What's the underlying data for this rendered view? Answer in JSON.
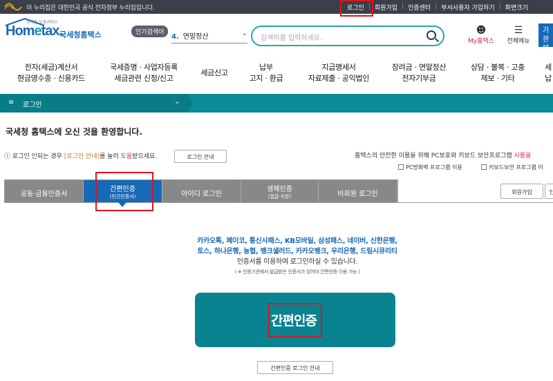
{
  "topbar": {
    "gov_text": "이 누리집은 대한민국 공식 전자정부 누리집입니다.",
    "links": [
      "로그인",
      "회원가입",
      "인증센터",
      "부서사용자 가입하기",
      "화면크기"
    ]
  },
  "header": {
    "slogan": "언제든 도움서비스",
    "logo_home": "Hom",
    "logo_e": "e",
    "logo_tax": "tax.",
    "site_name": "국세청홈택스",
    "popular_label": "인기검색어",
    "keyword_rank": "4.",
    "keyword": "연말정산",
    "search_placeholder": "검색어를 입력하세요.",
    "mytax": "My홈택스",
    "menu_all": "전체메뉴",
    "side_button_line1": "기관",
    "side_button_line2": "메"
  },
  "gnb": [
    {
      "l1": "전자(세금)계산서",
      "l2": "현금영수증 · 신용카드"
    },
    {
      "l1": "국세증명 · 사업자등록",
      "l2": "세금관련 신청/신고"
    },
    {
      "l1": "세금신고",
      "l2": ""
    },
    {
      "l1": "납부",
      "l2": "고지 · 환급"
    },
    {
      "l1": "지급명세서",
      "l2": "자료제출 · 공익법인"
    },
    {
      "l1": "장려금 · 연말정산",
      "l2": "전자기부금"
    },
    {
      "l1": "상담 · 불복 · 고충",
      "l2": "제보 · 기타"
    },
    {
      "l1": "세",
      "l2": "납"
    }
  ],
  "lnb": {
    "label": "로그인"
  },
  "main": {
    "welcome": "국세청 홈택스에 오신 것을 환영합니다.",
    "notice_a": "로그인 인되는 경우 ",
    "notice_b": "[로그인 안내]",
    "notice_c": "를 눌러 ",
    "notice_d": "도움",
    "notice_e": "받으세요.",
    "login_guide_btn": "로그인 안내",
    "security_text_a": "홈택스의 안전한 이용을 위해 PC보호와 키보드 보안프로그램 ",
    "security_text_b": "사용을",
    "chk_pc": "PC방화벽 프로그램 이용",
    "chk_kb": "키보드보안 프로그램 이",
    "tabs": [
      {
        "label": "공동·금융인증서",
        "sub": ""
      },
      {
        "label": "간편인증",
        "sub": "(민간인증서)"
      },
      {
        "label": "아이디 로그인",
        "sub": ""
      },
      {
        "label": "생체인증",
        "sub": "(얼굴·지문)"
      },
      {
        "label": "비회원 로그인",
        "sub": ""
      }
    ],
    "join_btn": "회원가입",
    "extra_btn": "인",
    "providers_l1": "카카오톡, 페이코, 통신사패스, KB모바일, 삼성패스, 네이버, 신한은행,",
    "providers_l2": "토스, 하나은행, 농협, 뱅크샐러드, 카카오뱅크, 우리은행, 드림시큐리티",
    "providers_l3": "인증서를 이용하여 로그인하실 수 있습니다.",
    "providers_note": "( ※ 인증기관에서 발급받은 인증서가 있어야 간편인증 이용 가능 )",
    "big_button": "간편인증",
    "guide_btn": "간편인증 로그인 안내"
  }
}
